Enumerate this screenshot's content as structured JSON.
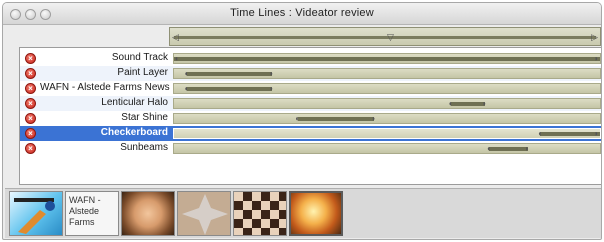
{
  "window": {
    "title": "Time Lines : Videator review"
  },
  "colors": {
    "selection": "#3b73d4",
    "segment": "#6f7053",
    "track": "#c9caaf",
    "delete": "#c8231b"
  },
  "layers": [
    {
      "label": "Sound Track",
      "selected": false,
      "segments": [
        [
          0.0,
          1.0
        ]
      ]
    },
    {
      "label": "Paint Layer",
      "selected": false,
      "segments": [
        [
          0.03,
          0.23
        ]
      ]
    },
    {
      "label": "WAFN - Alstede Farms News",
      "selected": false,
      "segments": [
        [
          0.03,
          0.23
        ]
      ]
    },
    {
      "label": "Lenticular Halo",
      "selected": false,
      "segments": [
        [
          0.65,
          0.73
        ]
      ]
    },
    {
      "label": "Star Shine",
      "selected": false,
      "segments": [
        [
          0.29,
          0.47
        ]
      ]
    },
    {
      "label": "Checkerboard",
      "selected": true,
      "segments": [
        [
          0.86,
          1.0
        ]
      ]
    },
    {
      "label": "Sunbeams",
      "selected": false,
      "segments": [
        [
          0.74,
          0.83
        ]
      ]
    }
  ],
  "thumbnails": [
    {
      "name": "paint-layer-thumbnail",
      "kind": "paint"
    },
    {
      "name": "wafn-thumbnail",
      "kind": "text",
      "lines": [
        "WAFN -",
        "Alstede",
        "Farms"
      ]
    },
    {
      "name": "lenticular-halo-thumbnail",
      "kind": "face"
    },
    {
      "name": "star-shine-thumbnail",
      "kind": "star"
    },
    {
      "name": "checkerboard-thumbnail",
      "kind": "checker"
    },
    {
      "name": "sunbeams-thumbnail",
      "kind": "sunbeam"
    }
  ]
}
